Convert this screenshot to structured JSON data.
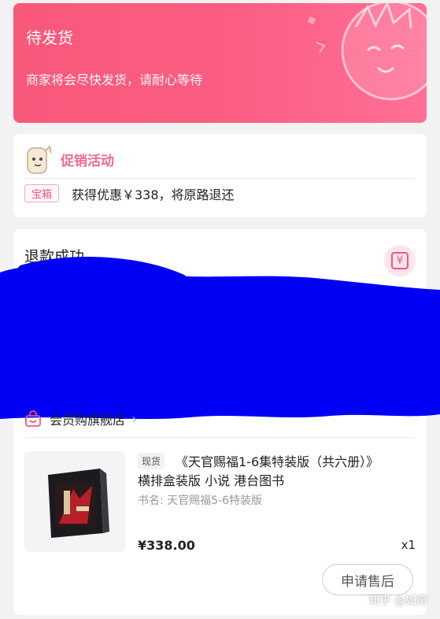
{
  "status": {
    "title": "待发货",
    "subtitle": "商家将会尽快发货，请耐心等待",
    "accent": "#f8587a"
  },
  "promo": {
    "title": "促销活动",
    "tag": "宝箱",
    "text": "获得优惠￥338，将原路退还",
    "accent": "#ef6b8c"
  },
  "refund": {
    "title": "退款成功",
    "icon": "yuan-icon"
  },
  "shop": {
    "name": "会员购旗舰店",
    "icon": "shopping-bag-icon",
    "arrow": "›"
  },
  "product": {
    "badge": "现货",
    "title_line1": "《天官赐福1-6集特装版（共六册）》",
    "title_line2": "横排盒装版 小说 港台图书",
    "spec": "书名: 天官赐福5-6特装版",
    "price": "¥338.00",
    "quantity": "x1",
    "image_icon": "book-box-icon"
  },
  "actions": {
    "after_sale": "申请售后"
  },
  "watermark": "知乎 @如愿",
  "redaction_color": "#0000f5"
}
